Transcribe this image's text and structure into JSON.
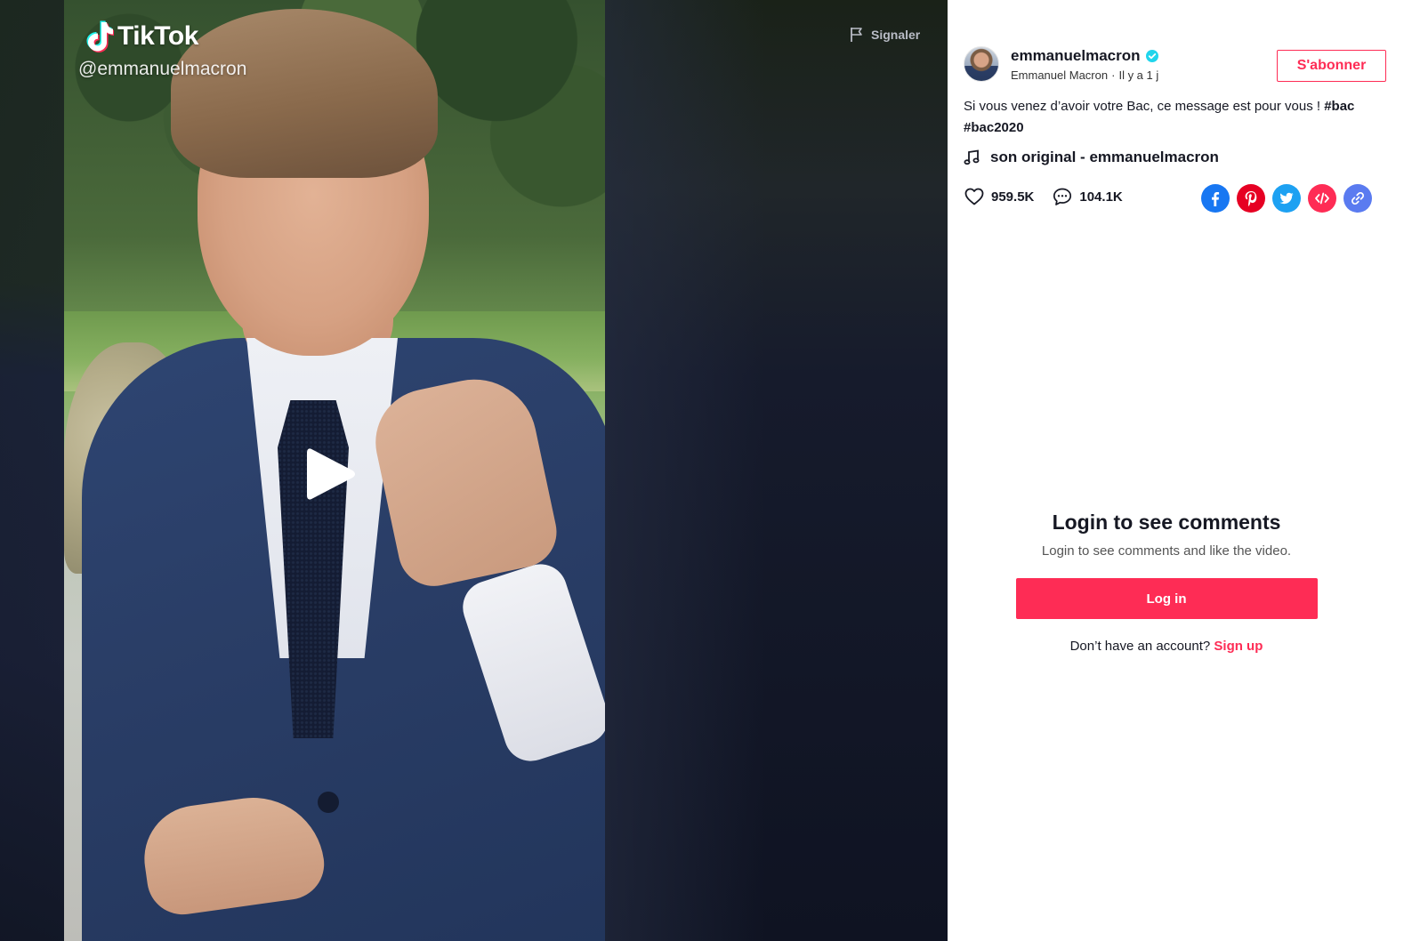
{
  "video": {
    "watermark_brand": "TikTok",
    "watermark_handle": "@emmanuelmacron",
    "report_label": "Signaler"
  },
  "author": {
    "username": "emmanuelmacron",
    "display_name": "Emmanuel Macron",
    "separator": "·",
    "posted": "Il y a 1 j",
    "follow_label": "S'abonner"
  },
  "caption": {
    "text": "Si vous venez d’avoir votre Bac, ce message est pour vous !",
    "hashtags": [
      "#bac",
      "#bac2020"
    ]
  },
  "music": {
    "label": "son original - emmanuelmacron"
  },
  "stats": {
    "likes": "959.5K",
    "comments": "104.1K"
  },
  "share_icons": [
    "facebook-icon",
    "pinterest-icon",
    "twitter-icon",
    "embed-icon",
    "link-icon"
  ],
  "colors": {
    "accent": "#fe2c55",
    "facebook": "#1877f2",
    "pinterest": "#e60023",
    "twitter": "#1da1f2",
    "embed": "#fe2c55",
    "link": "#5a7bf0",
    "verified": "#20d5ec"
  },
  "comments_gate": {
    "title": "Login to see comments",
    "subtitle": "Login to see comments and like the video.",
    "login_label": "Log in",
    "no_account_text": "Don’t have an account?",
    "signup_label": "Sign up"
  }
}
